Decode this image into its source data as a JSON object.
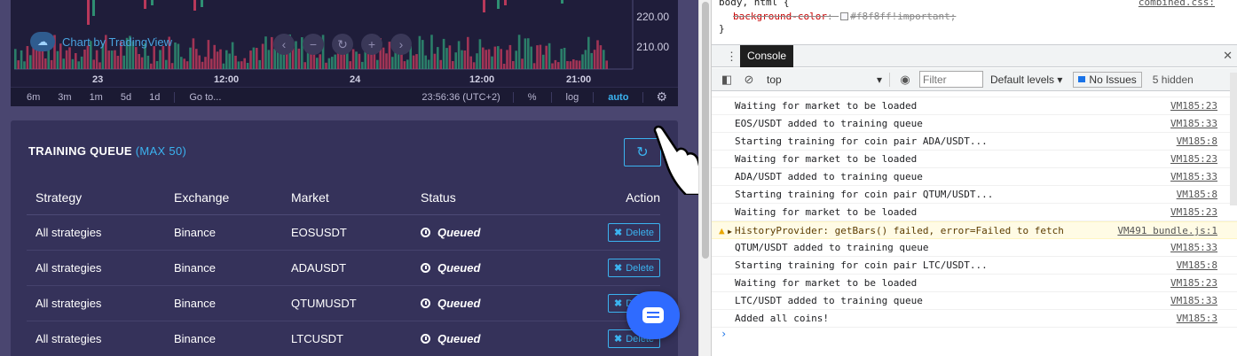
{
  "chart": {
    "badge_label": "Chart by TradingView",
    "price_labels": [
      "220.00",
      "210.00"
    ],
    "time_labels": [
      "23",
      "12:00",
      "24",
      "12:00",
      "21:00"
    ],
    "toolbar": {
      "ranges": [
        "6m",
        "3m",
        "1m",
        "5d",
        "1d"
      ],
      "goto": "Go to...",
      "clock": "23:56:36 (UTC+2)",
      "percent": "%",
      "log": "log",
      "auto": "auto"
    },
    "nav_buttons": [
      "‹",
      "−",
      "↻",
      "+",
      "›"
    ]
  },
  "queue": {
    "title": "TRAINING QUEUE",
    "max_label": "(MAX 50)",
    "columns": [
      "Strategy",
      "Exchange",
      "Market",
      "Status",
      "Action"
    ],
    "rows": [
      {
        "strategy": "All strategies",
        "exchange": "Binance",
        "market": "EOSUSDT",
        "status": "Queued",
        "action": "Delete"
      },
      {
        "strategy": "All strategies",
        "exchange": "Binance",
        "market": "ADAUSDT",
        "status": "Queued",
        "action": "Delete"
      },
      {
        "strategy": "All strategies",
        "exchange": "Binance",
        "market": "QTUMUSDT",
        "status": "Queued",
        "action": "Delete"
      },
      {
        "strategy": "All strategies",
        "exchange": "Binance",
        "market": "LTCUSDT",
        "status": "Queued",
        "action": "Delete"
      }
    ]
  },
  "devtools": {
    "styles": {
      "selector": "body, html {",
      "source": "combined.css:",
      "property_name": "background-color",
      "property_value": "#f8f8ff!important;",
      "close": "}"
    },
    "drawer_tab": "Console",
    "toolbar": {
      "context": "top",
      "filter_placeholder": "Filter",
      "levels": "Default levels",
      "issues": "No Issues",
      "hidden": "5 hidden"
    },
    "logs": [
      {
        "msg": "",
        "src": "",
        "type": "partial"
      },
      {
        "msg": "Waiting for market to be loaded",
        "src": "VM185:23",
        "type": "log"
      },
      {
        "msg": "EOS/USDT added to training queue",
        "src": "VM185:33",
        "type": "log"
      },
      {
        "msg": "Starting training for coin pair ADA/USDT...",
        "src": "VM185:8",
        "type": "log"
      },
      {
        "msg": "Waiting for market to be loaded",
        "src": "VM185:23",
        "type": "log"
      },
      {
        "msg": "ADA/USDT added to training queue",
        "src": "VM185:33",
        "type": "log"
      },
      {
        "msg": "Starting training for coin pair QTUM/USDT...",
        "src": "VM185:8",
        "type": "log"
      },
      {
        "msg": "Waiting for market to be loaded",
        "src": "VM185:23",
        "type": "log"
      },
      {
        "msg": "HistoryProvider: getBars() failed, error=Failed to fetch",
        "src": "VM491 bundle.js:1",
        "type": "warn"
      },
      {
        "msg": "QTUM/USDT added to training queue",
        "src": "VM185:33",
        "type": "log"
      },
      {
        "msg": "Starting training for coin pair LTC/USDT...",
        "src": "VM185:8",
        "type": "log"
      },
      {
        "msg": "Waiting for market to be loaded",
        "src": "VM185:23",
        "type": "log"
      },
      {
        "msg": "LTC/USDT added to training queue",
        "src": "VM185:33",
        "type": "log"
      },
      {
        "msg": "Added all coins!",
        "src": "VM185:3",
        "type": "log"
      }
    ],
    "prompt": "›"
  },
  "colors": {
    "accent": "#3bb3f0",
    "panel": "#35325a",
    "chart_bg": "#1f1d3a",
    "candle_up": "#2e8f72",
    "candle_down": "#b8385a",
    "chat": "#2f6bff"
  }
}
